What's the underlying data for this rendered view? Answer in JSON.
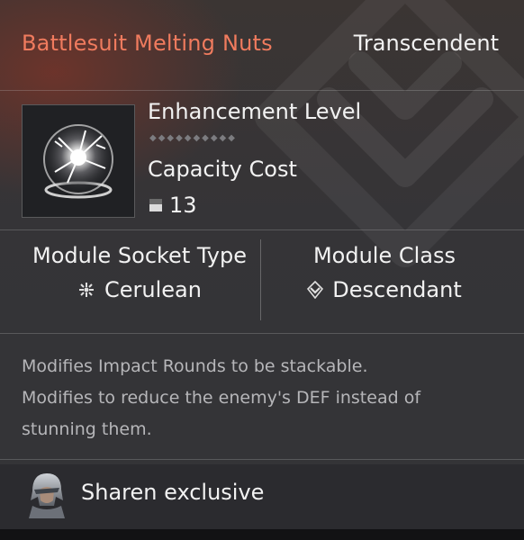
{
  "module": {
    "name": "Battlesuit Melting Nuts",
    "rarity": "Transcendent",
    "enhancement_label": "Enhancement Level",
    "enhancement_level": 0,
    "enhancement_max": 10,
    "capacity_label": "Capacity Cost",
    "capacity_value": "13",
    "capacity_icon": "capacity-icon",
    "socket_title": "Module Socket Type",
    "socket_value": "Cerulean",
    "socket_icon": "cerulean-socket-icon",
    "class_title": "Module Class",
    "class_value": "Descendant",
    "class_icon": "descendant-class-icon",
    "description_lines": [
      "Modifies Impact Rounds to be stackable.",
      "Modifies to reduce the enemy's DEF instead of",
      "stunning them."
    ],
    "exclusive_text": "Sharen exclusive",
    "thumbnail_icon": "module-sphere-icon"
  },
  "colors": {
    "title": "#f07b5e",
    "text": "#f2f2f2",
    "muted": "#b6b6b9"
  }
}
